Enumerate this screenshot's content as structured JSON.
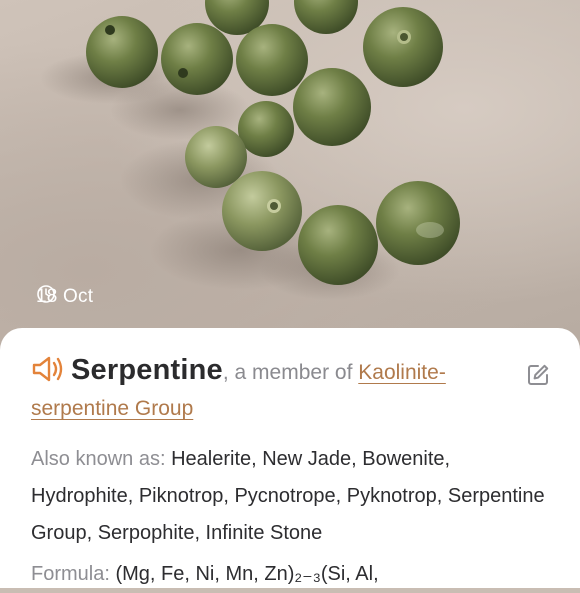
{
  "photo": {
    "date": "18 Oct"
  },
  "mineral": {
    "name": "Serpentine",
    "member_prefix": ", a member of ",
    "group_link": "Kaolinite-serpentine Group"
  },
  "aka": {
    "label": "Also known as:",
    "names": "Healerite, New Jade, Bowenite, Hydrophite, Piknotrop, Pycnotrope, Pyknotrop, Serpentine Group, Serpophite, Infinite Stone"
  },
  "formula": {
    "label": "Formula:",
    "value": "(Mg, Fe, Ni, Mn, Zn)₂₋₃(Si, Al,"
  },
  "colors": {
    "accent_orange": "#e3833a",
    "link_brown": "#b07a4c"
  }
}
